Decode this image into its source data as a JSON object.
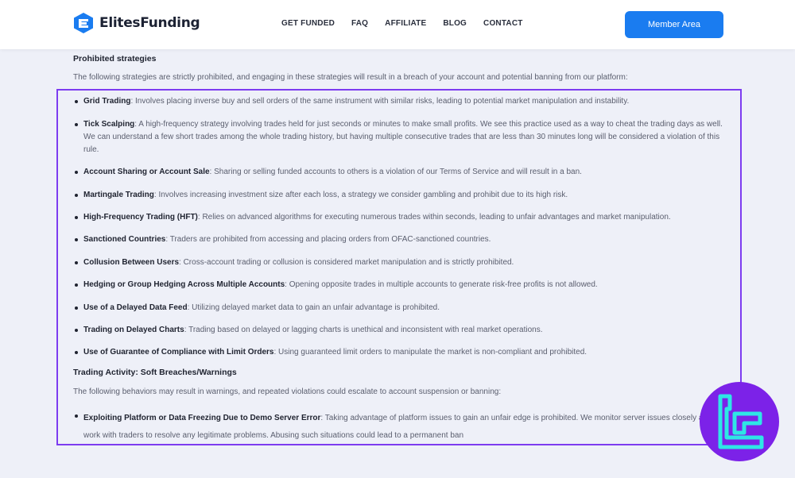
{
  "brand": {
    "name": "ElitesFunding",
    "accent": "#1a7cf0"
  },
  "nav": {
    "items": [
      "GET FUNDED",
      "FAQ",
      "AFFILIATE",
      "BLOG",
      "CONTACT"
    ]
  },
  "header": {
    "member_button": "Member Area"
  },
  "prohibited": {
    "title": "Prohibited strategies",
    "description": "The following strategies are strictly prohibited, and engaging in these strategies will result in a breach of your account and potential banning from our platform:",
    "items": [
      {
        "term": "Grid Trading",
        "text": ": Involves placing inverse buy and sell orders of the same instrument with similar risks, leading to potential market manipulation and instability."
      },
      {
        "term": "Tick Scalping",
        "text": ": A high-frequency strategy involving trades held for just seconds or minutes to make small profits. We see this practice used as a way to cheat the trading days as well. We can understand a few short trades among the whole trading history, but having multiple consecutive trades that are less than 30 minutes long will be considered a violation of this rule."
      },
      {
        "term": "Account Sharing or Account Sale",
        "text": ": Sharing or selling funded accounts to others is a violation of our Terms of Service and will result in a ban."
      },
      {
        "term": "Martingale Trading",
        "text": ": Involves increasing investment size after each loss, a strategy we consider gambling and prohibit due to its high risk."
      },
      {
        "term": "High-Frequency Trading (HFT)",
        "text": ": Relies on advanced algorithms for executing numerous trades within seconds, leading to unfair advantages and market manipulation."
      },
      {
        "term": "Sanctioned Countries",
        "text": ": Traders are prohibited from accessing and placing orders from OFAC-sanctioned countries."
      },
      {
        "term": "Collusion Between Users",
        "text": ": Cross-account trading or collusion is considered market manipulation and is strictly prohibited."
      },
      {
        "term": "Hedging or Group Hedging Across Multiple Accounts",
        "text": ": Opening opposite trades in multiple accounts to generate risk-free profits is not allowed."
      },
      {
        "term": "Use of a Delayed Data Feed",
        "text": ": Utilizing delayed market data to gain an unfair advantage is prohibited."
      },
      {
        "term": "Trading on Delayed Charts",
        "text": ": Trading based on delayed or lagging charts is unethical and inconsistent with real market operations."
      },
      {
        "term": "Use of Guarantee of Compliance with Limit Orders",
        "text": ": Using guaranteed limit orders to manipulate the market is non-compliant and prohibited."
      }
    ]
  },
  "soft": {
    "title": "Trading Activity: Soft Breaches/Warnings",
    "description": "The following behaviors may result in warnings, and repeated violations could escalate to account suspension or banning:",
    "items": [
      {
        "term": "Exploiting Platform or Data Freezing Due to Demo Server Error",
        "text": ": Taking advantage of platform issues to gain an unfair edge is prohibited. We monitor server issues closely and work with traders to resolve any legitimate problems. Abusing such situations could lead to a permanent ban"
      }
    ]
  },
  "highlight_color": "#7d3cf0",
  "badge": {
    "icon": "tradingfinder-logo-icon",
    "color": "#7c22e8"
  }
}
